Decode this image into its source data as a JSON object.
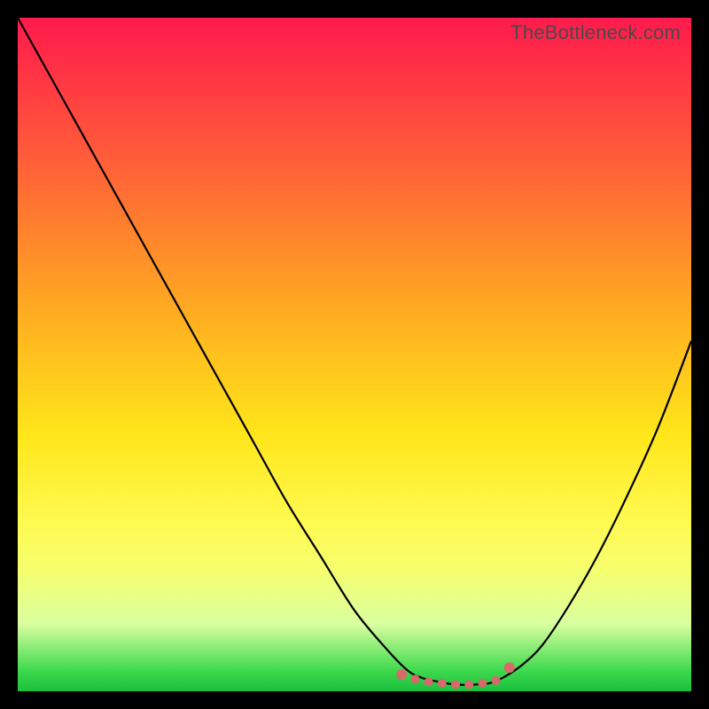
{
  "watermark": "TheBottleneck.com",
  "chart_data": {
    "type": "line",
    "title": "",
    "xlabel": "",
    "ylabel": "",
    "xlim": [
      0,
      100
    ],
    "ylim": [
      0,
      100
    ],
    "series": [
      {
        "name": "bottleneck-curve",
        "x": [
          0,
          5,
          10,
          15,
          20,
          25,
          30,
          35,
          40,
          45,
          50,
          55,
          58,
          60,
          62,
          65,
          68,
          70,
          72,
          75,
          78,
          82,
          86,
          90,
          95,
          100
        ],
        "values": [
          100,
          91,
          82,
          73,
          64,
          55,
          46,
          37,
          28,
          20,
          12,
          6,
          3,
          2,
          1.5,
          1,
          1,
          1.2,
          2,
          4,
          7,
          13,
          20,
          28,
          39,
          52
        ]
      }
    ],
    "markers": {
      "name": "optimal-range-dots",
      "color": "#d66a6a",
      "x": [
        57,
        59,
        61,
        63,
        65,
        67,
        69,
        71,
        73
      ],
      "values": [
        2.5,
        1.8,
        1.4,
        1.2,
        1.0,
        1.0,
        1.2,
        1.6,
        3.5
      ]
    }
  }
}
